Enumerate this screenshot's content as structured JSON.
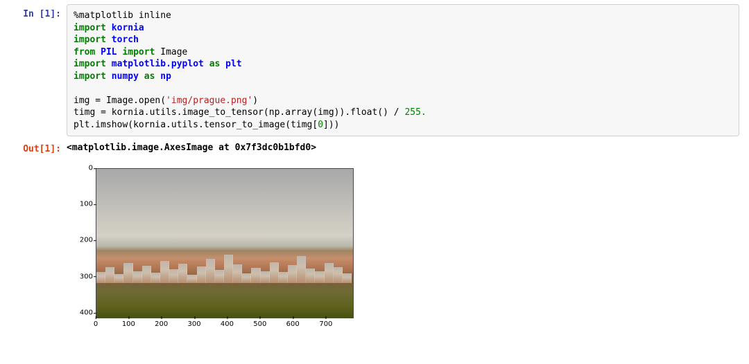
{
  "cells": {
    "in": {
      "prompt": "In [1]:",
      "code": {
        "l1": {
          "t1": "%matplotlib inline"
        },
        "l2": {
          "kw": "import",
          "mod": "kornia"
        },
        "l3": {
          "kw": "import",
          "mod": "torch"
        },
        "l4": {
          "kw1": "from",
          "mod1": "PIL",
          "kw2": "import",
          "t": "Image"
        },
        "l5": {
          "kw1": "import",
          "mod1": "matplotlib.pyplot",
          "kw2": "as",
          "mod2": "plt"
        },
        "l6": {
          "kw1": "import",
          "mod1": "numpy",
          "kw2": "as",
          "mod2": "np"
        },
        "l8": {
          "a": "img = Image.open(",
          "s": "'img/prague.png'",
          "b": ")"
        },
        "l9": {
          "a": "timg = kornia.utils.image_to_tensor(np.array(img)).float() / ",
          "n": "255.",
          "b": ""
        },
        "l10": {
          "a": "plt.imshow(kornia.utils.tensor_to_image(timg[",
          "n": "0",
          "b": "]))"
        }
      }
    },
    "out": {
      "prompt": "Out[1]:",
      "text": "<matplotlib.image.AxesImage at 0x7f3dc0b1bfd0>"
    }
  },
  "chart_data": {
    "type": "image",
    "xlim": [
      0,
      780
    ],
    "ylim": [
      440,
      0
    ],
    "xticks": [
      0,
      100,
      200,
      300,
      400,
      500,
      600,
      700
    ],
    "yticks": [
      0,
      100,
      200,
      300,
      400
    ],
    "title": "",
    "xlabel": "",
    "ylabel": "",
    "content_description": "photograph of Prague cityscape with orange rooftops, autumn trees in foreground, overcast grey sky"
  }
}
